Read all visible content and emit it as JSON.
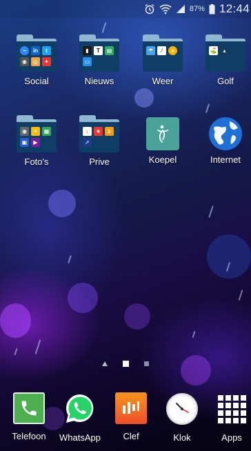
{
  "status_bar": {
    "battery_percent": "87%",
    "time": "12:44",
    "icons": [
      "alarm-icon",
      "wifi-icon",
      "signal-icon",
      "battery-icon"
    ]
  },
  "home": {
    "row1": [
      {
        "label": "Social",
        "type": "folder",
        "apps": [
          "messenger",
          "linkedin",
          "twitter",
          "camera",
          "instagram",
          "pinwheel"
        ]
      },
      {
        "label": "Nieuws",
        "type": "folder",
        "apps": [
          "nos",
          "nyt",
          "newspaper",
          "blue-app"
        ]
      },
      {
        "label": "Weer",
        "type": "folder",
        "apps": [
          "weather",
          "buienradar",
          "weather-color"
        ]
      },
      {
        "label": "Golf",
        "type": "folder",
        "apps": [
          "golf-gamebook",
          "golf-scorecard"
        ]
      }
    ],
    "row2": [
      {
        "label": "Foto's",
        "type": "folder",
        "apps": [
          "camera-app",
          "pinwheel-photos",
          "gallery",
          "photo-editor",
          "video-app"
        ]
      },
      {
        "label": "Prive",
        "type": "folder",
        "apps": [
          "download",
          "red-star",
          "pdf-app",
          "rocket"
        ]
      },
      {
        "label": "Koepel",
        "type": "app",
        "icon": "koepel-logo"
      },
      {
        "label": "Internet",
        "type": "app",
        "icon": "globe-icon"
      }
    ]
  },
  "dock": [
    {
      "label": "Telefoon",
      "icon": "phone-icon",
      "color": "#4caf50"
    },
    {
      "label": "WhatsApp",
      "icon": "whatsapp-icon",
      "color": "#25d366"
    },
    {
      "label": "Clef",
      "icon": "clef-bars-icon",
      "color": "#f05a28"
    },
    {
      "label": "Klok",
      "icon": "clock-icon",
      "color": "#ffffff"
    },
    {
      "label": "Apps",
      "icon": "app-grid-icon",
      "color": "#ffffff"
    }
  ],
  "page_indicator": {
    "pages": 2,
    "active": 1
  },
  "colors": {
    "folder_body": "#0e3e66",
    "folder_tab": "#8fb7cf",
    "koepel_bg": "#4aa39a",
    "globe_blue": "#1e6fd6"
  }
}
